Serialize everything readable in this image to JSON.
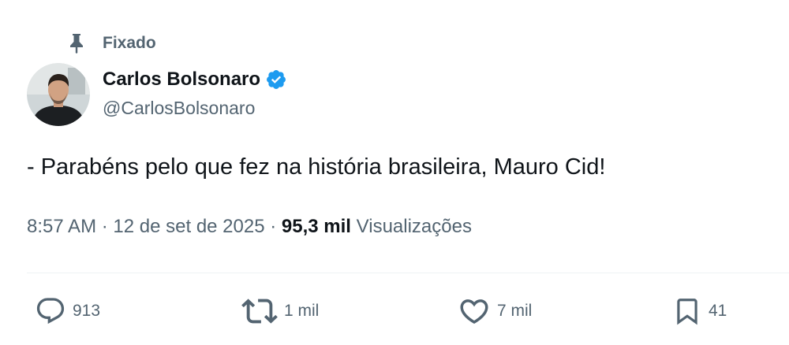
{
  "pinned": {
    "label": "Fixado",
    "icon": "pin-icon"
  },
  "author": {
    "display_name": "Carlos Bolsonaro",
    "handle": "@CarlosBolsonaro",
    "verified": true,
    "verified_color": "#1d9bf0"
  },
  "tweet": {
    "text": "- Parabéns pelo que fez na história brasileira, Mauro Cid!",
    "time": "8:57 AM",
    "separator": "·",
    "date": "12 de set de 2025",
    "views_count": "95,3 mil",
    "views_label": "Visualizações"
  },
  "actions": {
    "reply_count": "913",
    "repost_count": "1 mil",
    "like_count": "7 mil",
    "bookmark_count": "41"
  },
  "colors": {
    "text_primary": "#0f1419",
    "text_secondary": "#536471",
    "divider": "#eff3f4"
  }
}
